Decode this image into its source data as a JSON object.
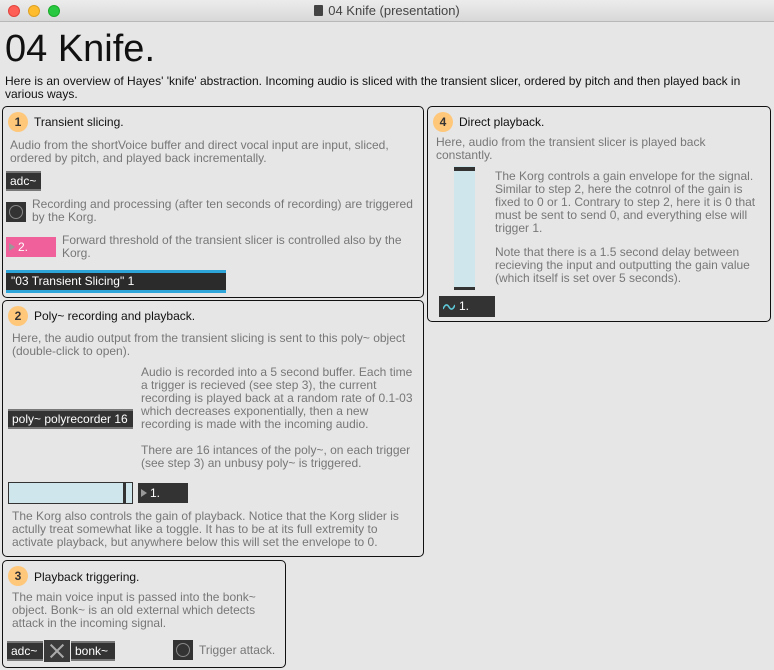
{
  "window": {
    "title": "04 Knife (presentation)"
  },
  "header": {
    "title": "04 Knife.",
    "intro": "Here is an overview of Hayes' 'knife' abstraction. Incoming audio is sliced with the transient slicer, ordered by pitch and then played back in various ways."
  },
  "section1": {
    "number": "1",
    "title": "Transient slicing.",
    "desc": "Audio from the shortVoice buffer and direct vocal input are input, sliced, ordered by pitch, and played back incrementally.",
    "adc_label": "adc~",
    "record_text": "Recording and processing (after ten seconds of recording) are triggered by the Korg.",
    "threshold_value": "2.",
    "threshold_text": "Forward threshold of the transient slicer is controlled also by the Korg.",
    "message_label": "\"03 Transient Slicing\" 1"
  },
  "section2": {
    "number": "2",
    "title": "Poly~ recording and playback.",
    "desc": "Here, the audio output from the transient slicing is sent to this poly~ object (double-click to open).",
    "poly_label": "poly~ polyrecorder 16",
    "buffer_text": "Audio is recorded into a 5 second buffer. Each time a trigger is recieved (see step 3), the current recording is played back at a random rate of 0.1-03 which decreases exponentially, then a new recording is made with the incoming audio.",
    "instances_text": "There are 16 intances of the poly~, on each trigger (see step 3) an unbusy poly~ is triggered.",
    "gain_value": "1.",
    "gain_text": "The Korg also controls the gain of playback. Notice that the Korg slider is actully treat somewhat like a toggle. It has to be at its full extremity to activate playback, but anywhere below this will set the envelope to 0."
  },
  "section3": {
    "number": "3",
    "title": "Playback triggering.",
    "desc": "The main voice input is passed into the bonk~ object. Bonk~ is an old external which detects attack in the incoming signal.",
    "adc_label": "adc~",
    "bonk_label": "bonk~",
    "trigger_text": "Trigger attack."
  },
  "section4": {
    "number": "4",
    "title": "Direct playback.",
    "desc": "Here, audio from the transient slicer is played back constantly.",
    "gain_text": "The Korg controls a gain envelope for the signal. Similar to step 2, here the cotnrol of the gain is fixed to 0 or 1. Contrary to step 2, here it is 0 that must be sent to send 0, and everything else will trigger 1.",
    "delay_text": "Note that there is a 1.5 second delay between recieving the input and outputting the gain value (which itself is set over 5 seconds).",
    "signal_value": "1."
  },
  "icons": [
    "window-close-icon",
    "window-minimize-icon",
    "window-maximize-icon",
    "document-icon",
    "toggle-icon",
    "inlet-arrow-icon",
    "signal-wave-icon",
    "bang-x-icon"
  ],
  "colors": {
    "badge": "#ffc77a",
    "slider_bg": "#cfe6ec",
    "message_accent": "#2ea5d9",
    "numbox_pink": "#f0609a",
    "wave": "#5ec8d8"
  }
}
